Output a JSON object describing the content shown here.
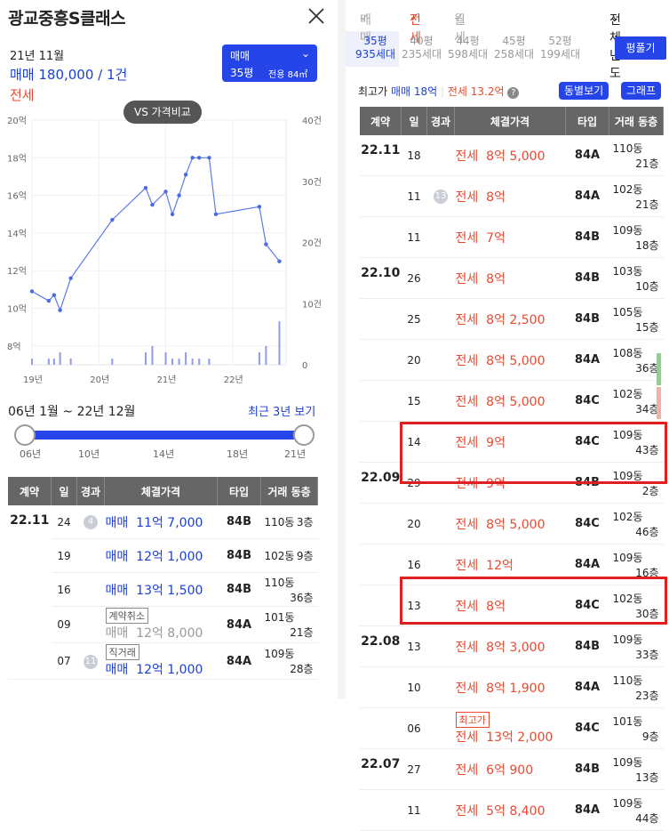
{
  "header": {
    "title": "광교중흥S클래스"
  },
  "summary": {
    "date": "21년 11월",
    "sale": "매매 180,000 / 1건",
    "jeonse": "전세"
  },
  "type_select": {
    "kind": "매매",
    "pyeong": "35평",
    "area": "전용 84㎡"
  },
  "vs_button": "VS 가격비교",
  "chart_data": {
    "type": "line",
    "title": "",
    "x_ticks": [
      "19년",
      "20년",
      "21년",
      "22년"
    ],
    "y_left_ticks": [
      "20억",
      "18억",
      "16억",
      "14억",
      "12억",
      "10억",
      "8억"
    ],
    "y_right_ticks": [
      "40건",
      "30건",
      "20건",
      "10건",
      "0"
    ],
    "ylim": [
      7,
      20
    ],
    "series": [
      {
        "values": [
          [
            2019.0,
            10.9
          ],
          [
            2019.25,
            10.4
          ],
          [
            2019.33,
            10.7
          ],
          [
            2019.42,
            9.9
          ],
          [
            2019.58,
            11.6
          ],
          [
            2020.2,
            14.7
          ],
          [
            2020.7,
            16.4
          ],
          [
            2020.8,
            15.5
          ],
          [
            2021.0,
            16.2
          ],
          [
            2021.1,
            15.0
          ],
          [
            2021.2,
            16.0
          ],
          [
            2021.3,
            17.1
          ],
          [
            2021.4,
            18.0
          ],
          [
            2021.5,
            18.0
          ],
          [
            2021.65,
            18.0
          ],
          [
            2021.75,
            15.0
          ],
          [
            2022.4,
            15.4
          ],
          [
            2022.5,
            13.4
          ],
          [
            2022.7,
            12.5
          ]
        ]
      }
    ],
    "volume": [
      [
        2019.0,
        1
      ],
      [
        2019.25,
        1
      ],
      [
        2019.33,
        1
      ],
      [
        2019.42,
        2
      ],
      [
        2019.58,
        1
      ],
      [
        2020.2,
        1
      ],
      [
        2020.7,
        2
      ],
      [
        2020.8,
        3
      ],
      [
        2021.0,
        2
      ],
      [
        2021.1,
        1
      ],
      [
        2021.2,
        1
      ],
      [
        2021.3,
        2
      ],
      [
        2021.4,
        1
      ],
      [
        2021.5,
        1
      ],
      [
        2021.65,
        1
      ],
      [
        2022.4,
        2
      ],
      [
        2022.5,
        3
      ],
      [
        2022.7,
        7
      ]
    ]
  },
  "range": {
    "label": "06년 1월 ~ 22년 12월",
    "recent": "최근 3년 보기",
    "ticks": [
      "06년",
      "10년",
      "14년",
      "18년",
      "21년"
    ]
  },
  "left_table": {
    "headers": [
      "계약",
      "일",
      "경과",
      "체결가격",
      "타입",
      "거래 동층"
    ],
    "month": "22.11",
    "rows": [
      {
        "day": "24",
        "badge": "4",
        "tag": "",
        "price": "매매  11억 7,000",
        "type": "84B",
        "dong": "110동",
        "floor": "3층",
        "style": "b"
      },
      {
        "day": "19",
        "badge": "",
        "tag": "",
        "price": "매매  12억 1,000",
        "type": "84B",
        "dong": "102동",
        "floor": "9층",
        "style": "b"
      },
      {
        "day": "16",
        "badge": "",
        "tag": "",
        "price": "매매  13억 1,500",
        "type": "84B",
        "dong": "110동",
        "floor": "36층",
        "style": "b"
      },
      {
        "day": "09",
        "badge": "",
        "tag": "계약취소",
        "price": "매매  12억 8,000",
        "type": "84A",
        "dong": "101동",
        "floor": "21층",
        "style": "g"
      },
      {
        "day": "07",
        "badge": "11",
        "tag": "직거래",
        "price": "매매  12억 1,000",
        "type": "84A",
        "dong": "109동",
        "floor": "28층",
        "style": "b"
      }
    ]
  },
  "right_top": {
    "tabs": [
      "매매",
      "전세",
      "월세"
    ],
    "year": "전체년도"
  },
  "sizes": [
    {
      "p": "35평",
      "h": "935세대"
    },
    {
      "p": "40평",
      "h": "235세대"
    },
    {
      "p": "44평",
      "h": "598세대"
    },
    {
      "p": "45평",
      "h": "258세대"
    },
    {
      "p": "52평",
      "h": "199세대"
    }
  ],
  "pyeong_btn": "평풀기",
  "maxline": {
    "label": "최고가",
    "sale": "매매 18억",
    "jeonse": "전세 13.2억",
    "dong_btn": "동별보기",
    "graph_btn": "그래프"
  },
  "right_table": {
    "headers": [
      "계약",
      "일",
      "경과",
      "체결가격",
      "타입",
      "거래 동층"
    ],
    "rows": [
      {
        "m": "22.11",
        "day": "18",
        "badge": "",
        "price": "전세  8억 5,000",
        "type": "84A",
        "dong": "110동",
        "floor": "21층"
      },
      {
        "m": "",
        "day": "11",
        "badge": "13",
        "price": "전세  8억",
        "type": "84A",
        "dong": "102동",
        "floor": "21층"
      },
      {
        "m": "",
        "day": "11",
        "badge": "",
        "price": "전세  7억",
        "type": "84B",
        "dong": "109동",
        "floor": "18층"
      },
      {
        "m": "22.10",
        "day": "26",
        "badge": "",
        "price": "전세  8억",
        "type": "84B",
        "dong": "103동",
        "floor": "10층"
      },
      {
        "m": "",
        "day": "25",
        "badge": "",
        "price": "전세  8억 2,500",
        "type": "84B",
        "dong": "105동",
        "floor": "15층"
      },
      {
        "m": "",
        "day": "20",
        "badge": "",
        "price": "전세  8억 5,000",
        "type": "84A",
        "dong": "108동",
        "floor": "36층"
      },
      {
        "m": "",
        "day": "15",
        "badge": "",
        "price": "전세  8억 5,000",
        "type": "84C",
        "dong": "102동",
        "floor": "34층"
      },
      {
        "m": "",
        "day": "14",
        "badge": "",
        "price": "전세  9억",
        "type": "84C",
        "dong": "109동",
        "floor": "43층"
      },
      {
        "m": "22.09",
        "day": "29",
        "badge": "",
        "price": "전세  9억",
        "type": "84B",
        "dong": "109동",
        "floor": "2층"
      },
      {
        "m": "",
        "day": "20",
        "badge": "",
        "price": "전세  8억 5,000",
        "type": "84C",
        "dong": "102동",
        "floor": "46층"
      },
      {
        "m": "",
        "day": "16",
        "badge": "",
        "price": "전세  12억",
        "type": "84A",
        "dong": "109동",
        "floor": "16층"
      },
      {
        "m": "",
        "day": "13",
        "badge": "",
        "price": "전세  8억",
        "type": "84C",
        "dong": "102동",
        "floor": "30층"
      },
      {
        "m": "22.08",
        "day": "13",
        "badge": "",
        "price": "전세  8억 3,000",
        "type": "84B",
        "dong": "109동",
        "floor": "33층"
      },
      {
        "m": "",
        "day": "10",
        "badge": "",
        "price": "전세  8억 1,900",
        "type": "84A",
        "dong": "110동",
        "floor": "23층"
      },
      {
        "m": "",
        "day": "06",
        "badge": "",
        "tag": "최고가",
        "price": "전세  13억 2,000",
        "type": "84C",
        "dong": "101동",
        "floor": "9층"
      },
      {
        "m": "22.07",
        "day": "27",
        "badge": "",
        "price": "전세  6억 900",
        "type": "84B",
        "dong": "109동",
        "floor": "13층"
      },
      {
        "m": "",
        "day": "11",
        "badge": "",
        "price": "전세  5억 8,400",
        "type": "84A",
        "dong": "109동",
        "floor": "44층"
      }
    ]
  }
}
